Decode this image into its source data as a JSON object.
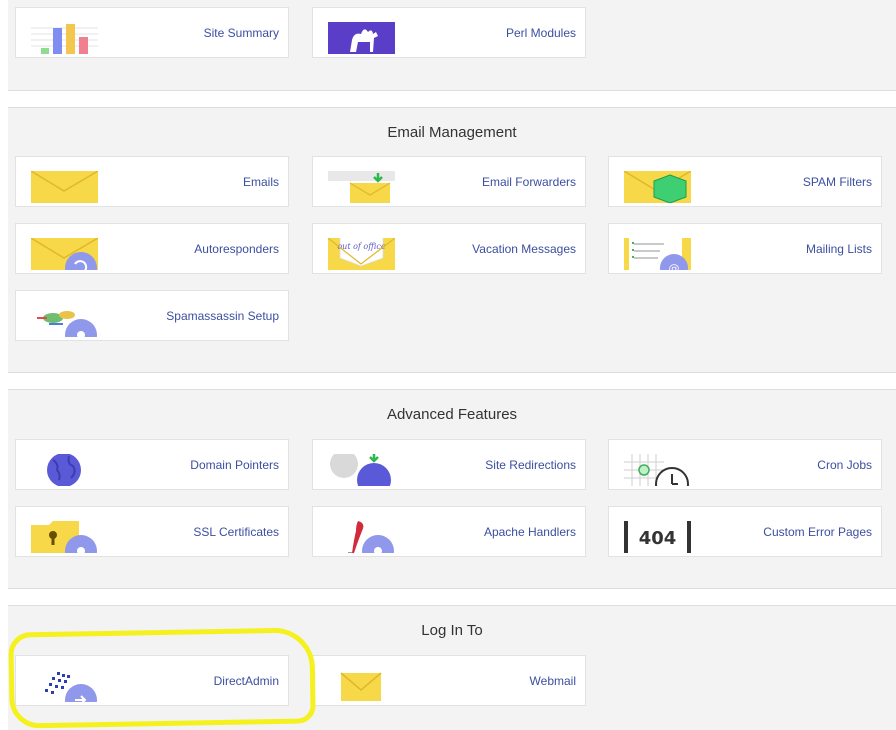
{
  "top": {
    "items": [
      {
        "label": "Site Summary",
        "icon": "site-summary-icon"
      },
      {
        "label": "Perl Modules",
        "icon": "perl-camel-icon"
      }
    ]
  },
  "email": {
    "title": "Email Management",
    "items": [
      {
        "label": "Emails",
        "icon": "envelope-icon"
      },
      {
        "label": "Email Forwarders",
        "icon": "email-forward-icon"
      },
      {
        "label": "SPAM Filters",
        "icon": "spam-shield-icon"
      },
      {
        "label": "Autoresponders",
        "icon": "autoresponder-icon"
      },
      {
        "label": "Vacation Messages",
        "icon": "vacation-message-icon",
        "thumb_text": "out of office"
      },
      {
        "label": "Mailing Lists",
        "icon": "mailing-list-icon"
      },
      {
        "label": "Spamassassin Setup",
        "icon": "spamassassin-icon"
      }
    ]
  },
  "advanced": {
    "title": "Advanced Features",
    "items": [
      {
        "label": "Domain Pointers",
        "icon": "globe-icon"
      },
      {
        "label": "Site Redirections",
        "icon": "redirect-globe-icon"
      },
      {
        "label": "Cron Jobs",
        "icon": "cron-clock-icon"
      },
      {
        "label": "SSL Certificates",
        "icon": "ssl-folder-icon"
      },
      {
        "label": "Apache Handlers",
        "icon": "apache-feather-icon"
      },
      {
        "label": "Custom Error Pages",
        "icon": "error-404-icon",
        "thumb_text": "404"
      }
    ]
  },
  "login": {
    "title": "Log In To",
    "items": [
      {
        "label": "DirectAdmin",
        "icon": "directadmin-icon"
      },
      {
        "label": "Webmail",
        "icon": "webmail-envelope-icon"
      }
    ]
  },
  "colors": {
    "link": "#3b4fa0",
    "panel_bg": "#f3f3f3",
    "highlight": "#f4f11e",
    "envelope": "#f7d848",
    "globe": "#5a5ad8"
  }
}
